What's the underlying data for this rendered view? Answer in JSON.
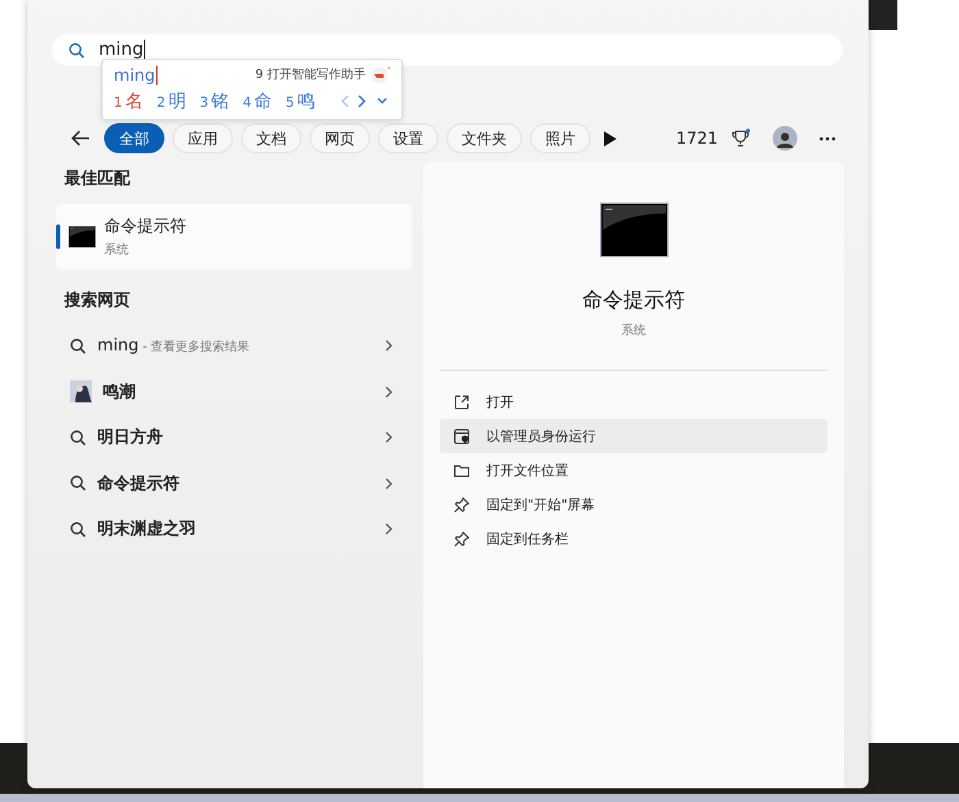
{
  "search": {
    "value": "ming"
  },
  "ime": {
    "composition": "ming",
    "assistant": "9 打开智能写作助手",
    "candidates": [
      {
        "index": "1",
        "text": "名",
        "selected": true
      },
      {
        "index": "2",
        "text": "明",
        "selected": false
      },
      {
        "index": "3",
        "text": "铭",
        "selected": false
      },
      {
        "index": "4",
        "text": "命",
        "selected": false
      },
      {
        "index": "5",
        "text": "鸣",
        "selected": false
      }
    ]
  },
  "tabs": [
    {
      "label": "全部",
      "selected": true
    },
    {
      "label": "应用",
      "selected": false
    },
    {
      "label": "文档",
      "selected": false
    },
    {
      "label": "网页",
      "selected": false
    },
    {
      "label": "设置",
      "selected": false
    },
    {
      "label": "文件夹",
      "selected": false
    },
    {
      "label": "照片",
      "selected": false
    }
  ],
  "points": "1721",
  "best_match": {
    "heading": "最佳匹配",
    "title": "命令提示符",
    "subtitle": "系统",
    "selected": true
  },
  "web_search": {
    "heading": "搜索网页",
    "items": [
      {
        "kind": "search",
        "text": "ming",
        "hint": " - 查看更多搜索结果"
      },
      {
        "text": "鸣潮"
      },
      {
        "kind": "search",
        "text": "明日方舟"
      },
      {
        "kind": "search",
        "text": "命令提示符"
      },
      {
        "kind": "search",
        "text": "明末渊虚之羽"
      }
    ]
  },
  "detail": {
    "title": "命令提示符",
    "subtitle": "系统",
    "actions": [
      {
        "kind": "open",
        "label": "打开",
        "selected": false
      },
      {
        "kind": "admin",
        "label": "以管理员身份运行",
        "selected": true
      },
      {
        "kind": "folder",
        "label": "打开文件位置",
        "selected": false
      },
      {
        "kind": "pin",
        "label": "固定到\"开始\"屏幕",
        "selected": false
      },
      {
        "kind": "pin",
        "label": "固定到任务栏",
        "selected": false
      }
    ]
  }
}
